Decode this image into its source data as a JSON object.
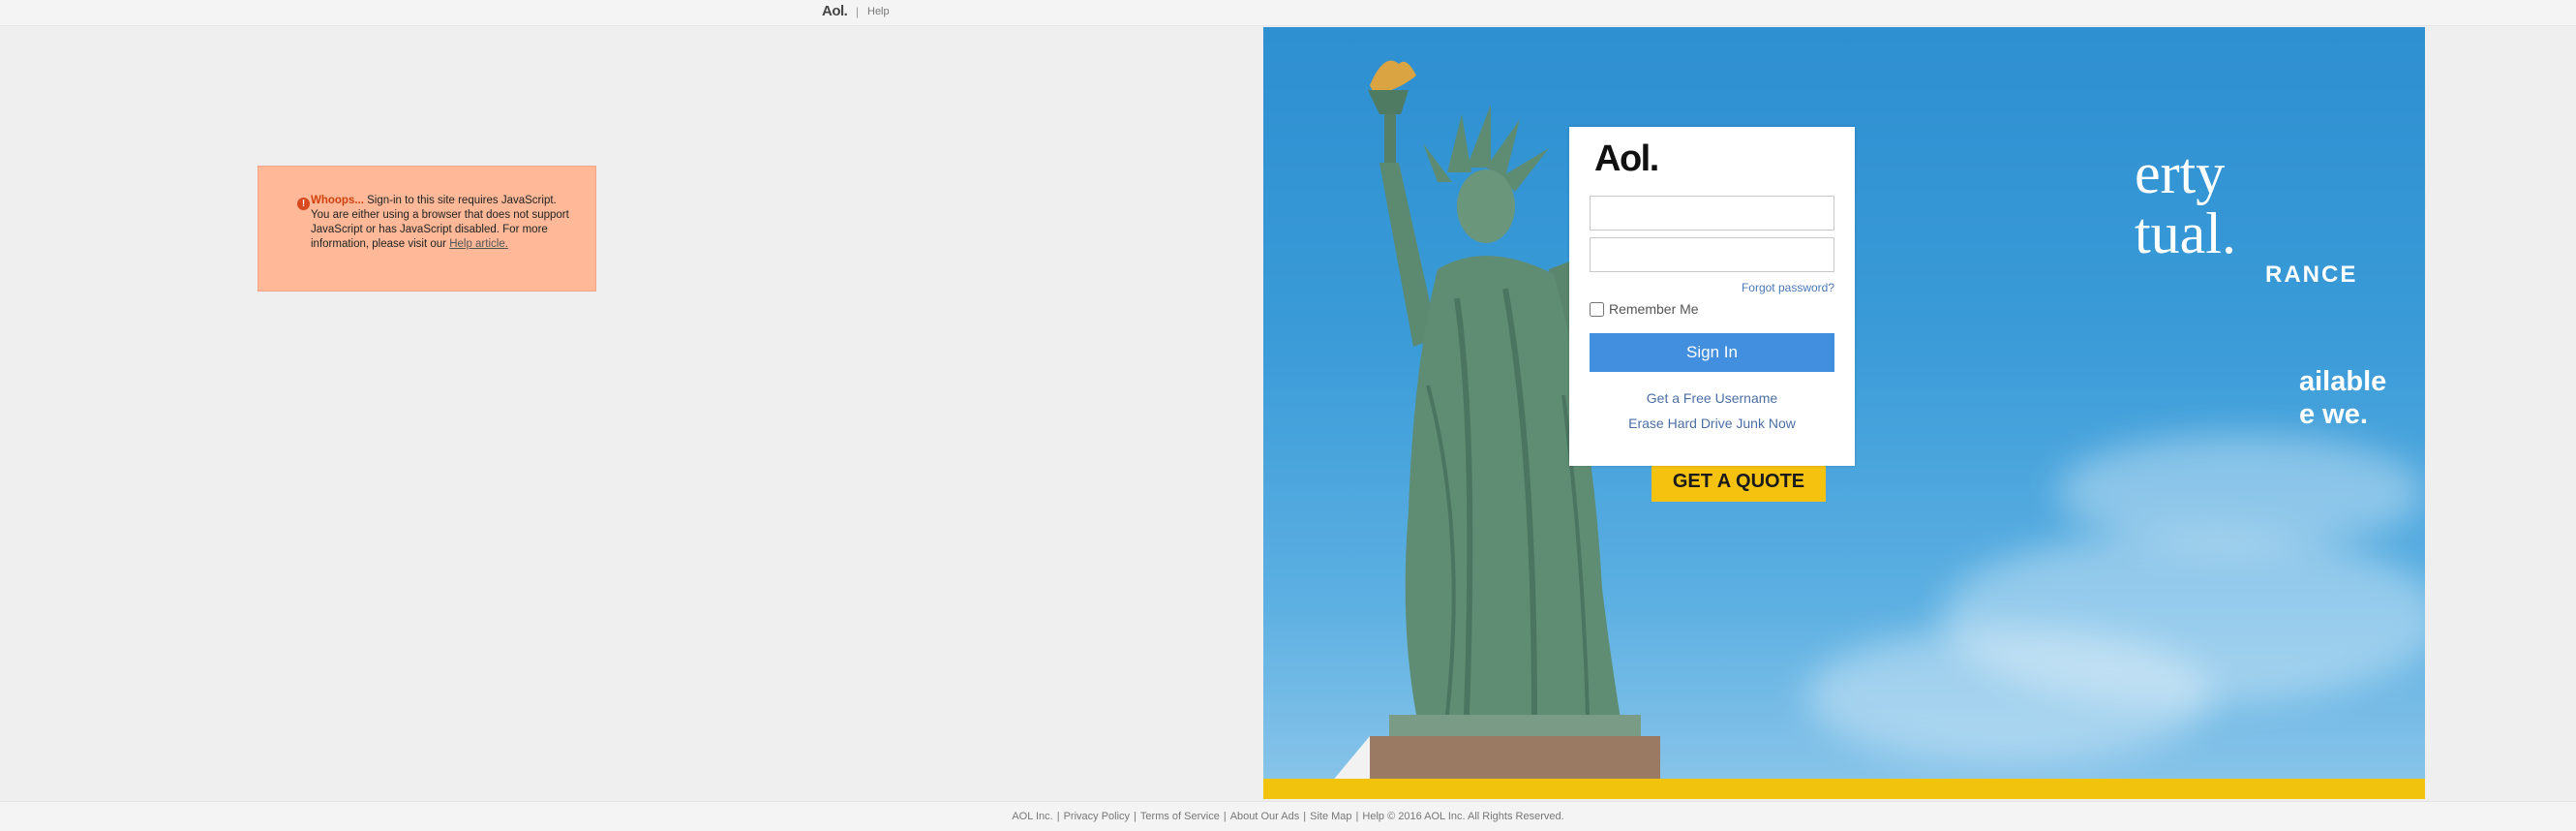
{
  "topbar": {
    "logo": "Aol.",
    "separator": "|",
    "help": "Help"
  },
  "error": {
    "title": "Whoops...",
    "message": "Sign-in to this site requires JavaScript. You are either using a browser that does not support JavaScript or has JavaScript disabled. For more information, please visit our",
    "link": "Help article."
  },
  "ad": {
    "brand_line1": "erty",
    "brand_line2": "tual.",
    "insurance": "RANCE",
    "tagline1": "ailable",
    "tagline2": "e we.",
    "cta": "GET A QUOTE"
  },
  "login": {
    "logo": "Aol.",
    "username_value": "",
    "password_value": "",
    "forgot": "Forgot password?",
    "remember": "Remember Me",
    "signin": "Sign In",
    "free_username": "Get a Free Username",
    "erase": "Erase Hard Drive Junk Now"
  },
  "footer": {
    "links": [
      "AOL Inc.",
      "Privacy Policy",
      "Terms of Service",
      "About Our Ads",
      "Site Map",
      "Help"
    ],
    "copyright": "© 2016 AOL Inc. All Rights Reserved."
  },
  "colors": {
    "signin_blue": "#418fde",
    "error_bg": "#ffb998",
    "cta_yellow": "#f4c20f",
    "sky_blue": "#3a9bd8"
  }
}
